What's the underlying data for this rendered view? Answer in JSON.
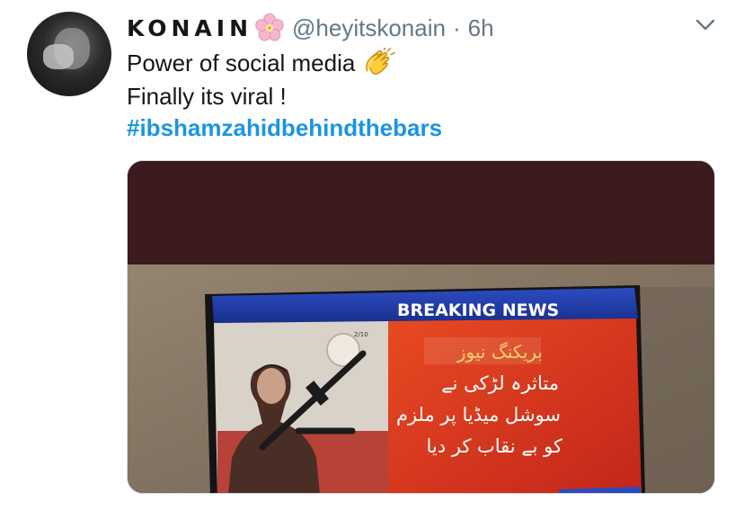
{
  "tweet": {
    "display_name": "KONAIN",
    "handle": "@heyitskonain",
    "separator": "·",
    "time": "6h",
    "text_line1": "Power of social media",
    "text_line2": "Finally its viral !",
    "hashtag": "#ibshamzahidbehindthebars"
  },
  "media": {
    "banner": "BREAKING NEWS",
    "urdu_heading": "بریکنگ نیوز",
    "urdu_lines": [
      "متاثرہ لڑکی نے",
      "سوشل میڈیا پر ملزم",
      "کو بے نقاب کر دیا"
    ],
    "tv_badge": "2/10"
  },
  "icons": {
    "name_emoji": "cherry-blossom-icon",
    "text_emoji": "clapping-hands-icon",
    "menu": "chevron-down-icon"
  },
  "colors": {
    "link": "#1b95e0",
    "secondary_text": "#657786",
    "banner_blue": "#1f3ba8",
    "news_red": "#d8301c"
  }
}
